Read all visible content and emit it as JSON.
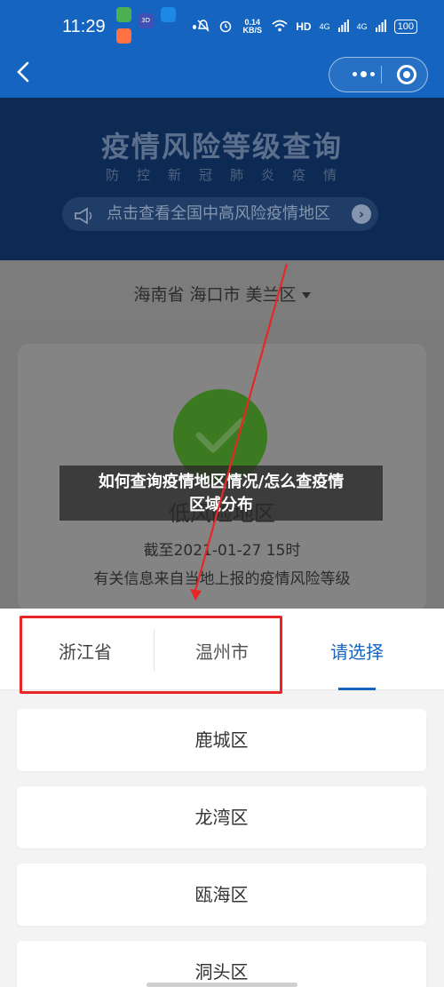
{
  "status_bar": {
    "time": "11:29",
    "app_icons": [
      {
        "name": "wechat-icon",
        "color": "#4caf50",
        "text": ""
      },
      {
        "name": "news-app-icon",
        "color": "#3f51b5",
        "text": "3D"
      },
      {
        "name": "store-app-icon",
        "color": "#1e88e5",
        "text": ""
      },
      {
        "name": "orange-app-icon",
        "color": "#ff7043",
        "text": ""
      }
    ],
    "net_speed": "0.14 KB/S",
    "network_label": "HD",
    "signal_1": "4G",
    "signal_2": "4G",
    "battery": "100"
  },
  "banner": {
    "title": "疫情风险等级查询",
    "subtitle": "防控新冠肺炎疫情",
    "notice": "点击查看全国中高风险疫情地区"
  },
  "region_selector": {
    "value": "海南省 海口市 美兰区"
  },
  "result": {
    "risk_level_partial": "低风险地区",
    "as_of": "截至2021-01-27 15时",
    "source_note": "有关信息来自当地上报的疫情风险等级"
  },
  "overlay_caption": {
    "line1": "如何查询疫情地区情况/怎么查疫情",
    "line2": "区域分布"
  },
  "picker": {
    "tabs": [
      {
        "label": "浙江省",
        "active": false
      },
      {
        "label": "温州市",
        "active": false
      },
      {
        "label": "请选择",
        "active": true
      }
    ],
    "items": [
      {
        "label": "鹿城区"
      },
      {
        "label": "龙湾区"
      },
      {
        "label": "瓯海区"
      },
      {
        "label": "洞头区"
      }
    ]
  },
  "colors": {
    "brand_blue": "#1565c0",
    "annotation_red": "#e82626",
    "low_risk_green": "#3c7a22"
  }
}
